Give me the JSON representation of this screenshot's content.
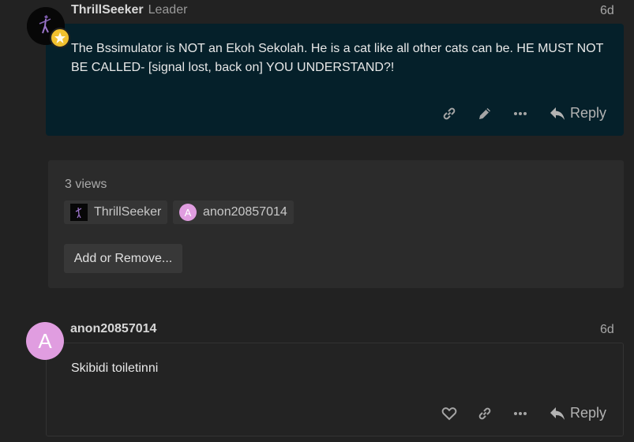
{
  "post1": {
    "username": "ThrillSeeker",
    "user_title": "Leader",
    "date": "6d",
    "text": "The Bssimulator is NOT an Ekoh Sekolah. He is a cat like all other cats can be. HE MUST NOT BE CALLED- [signal lost, back on] YOU UNDERSTAND?!",
    "reply_label": "Reply",
    "icons": [
      "link-icon",
      "pencil-icon",
      "more-icon",
      "reply-icon"
    ]
  },
  "views": {
    "count_label": "3 views",
    "chips": [
      {
        "name": "ThrillSeeker"
      },
      {
        "initial": "A",
        "name": "anon20857014"
      }
    ],
    "add_button": "Add or Remove..."
  },
  "post2": {
    "avatar_initial": "A",
    "username": "anon20857014",
    "date": "6d",
    "text": "Skibidi toiletinni",
    "reply_label": "Reply",
    "icons": [
      "heart-icon",
      "link-icon",
      "more-icon",
      "reply-icon"
    ]
  },
  "colors": {
    "page_bg": "#222222",
    "post_highlight_bg": "#05202a",
    "flair": "#f2c12e",
    "anon_avatar": "#e09de0"
  }
}
